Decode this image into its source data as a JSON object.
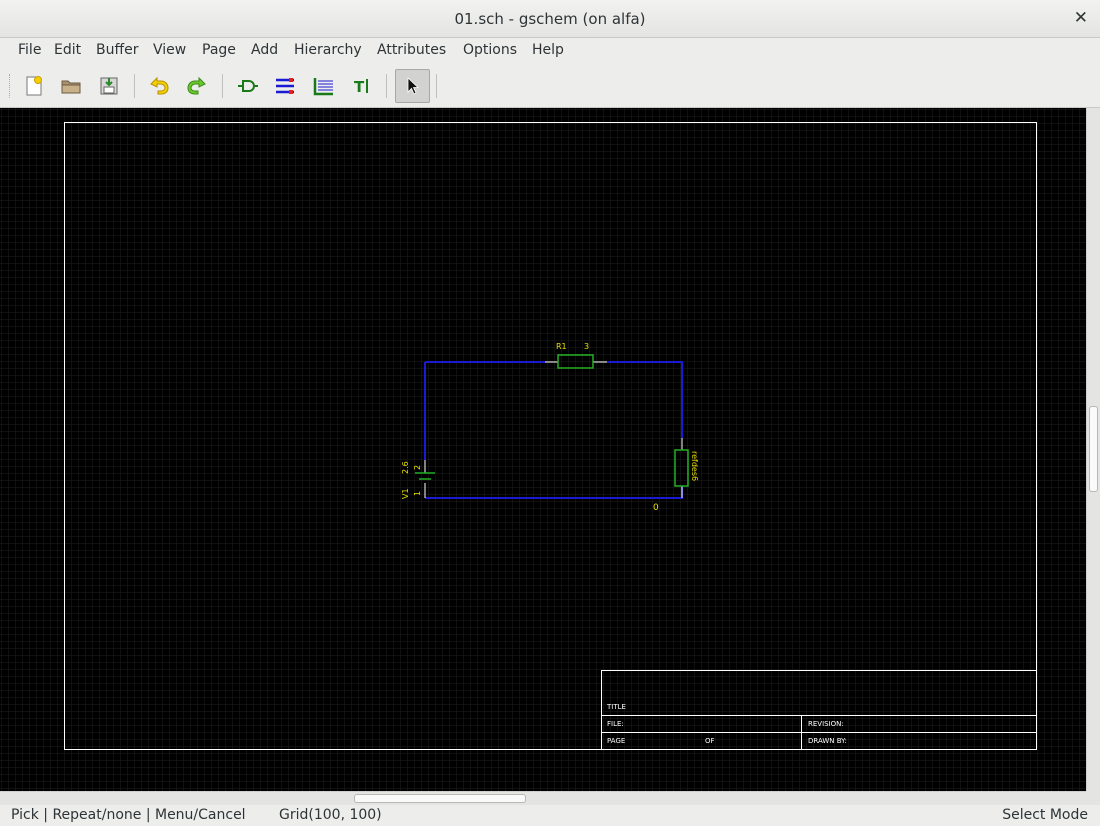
{
  "window": {
    "title": "01.sch - gschem (on alfa)"
  },
  "menu": [
    "File",
    "Edit",
    "Buffer",
    "View",
    "Page",
    "Add",
    "Hierarchy",
    "Attributes",
    "Options",
    "Help"
  ],
  "toolbar": {
    "buttons": [
      {
        "name": "new-file-icon",
        "active": false
      },
      {
        "name": "open-folder-icon",
        "active": false
      },
      {
        "name": "save-icon",
        "active": false
      },
      {
        "name": "undo-icon",
        "active": false
      },
      {
        "name": "redo-icon",
        "active": false
      },
      {
        "name": "add-component-icon",
        "active": false
      },
      {
        "name": "add-net-icon",
        "active": false
      },
      {
        "name": "add-bus-icon",
        "active": false
      },
      {
        "name": "add-text-icon",
        "active": false
      },
      {
        "name": "select-pointer-icon",
        "active": true
      }
    ]
  },
  "schematic": {
    "resistor_label": "R1",
    "resistor_pin": "3",
    "source_label": "V1",
    "source_value": "2.6",
    "source_pin_top": "2",
    "source_pin_bottom": "1",
    "resistor2_label": "refdes6",
    "ground_node": "0",
    "title_block": {
      "title": "TITLE",
      "file": "FILE:",
      "page": "PAGE",
      "of": "OF",
      "revision": "REVISION:",
      "drawn_by": "DRAWN BY:"
    },
    "colors": {
      "net": "#1a1ad2",
      "component": "#22b022",
      "text": "#e8e000",
      "frame": "#ffffff",
      "grid": "#2a2a2a"
    }
  },
  "status": {
    "hint": "Pick | Repeat/none | Menu/Cancel",
    "grid": "Grid(100, 100)",
    "mode": "Select Mode"
  }
}
